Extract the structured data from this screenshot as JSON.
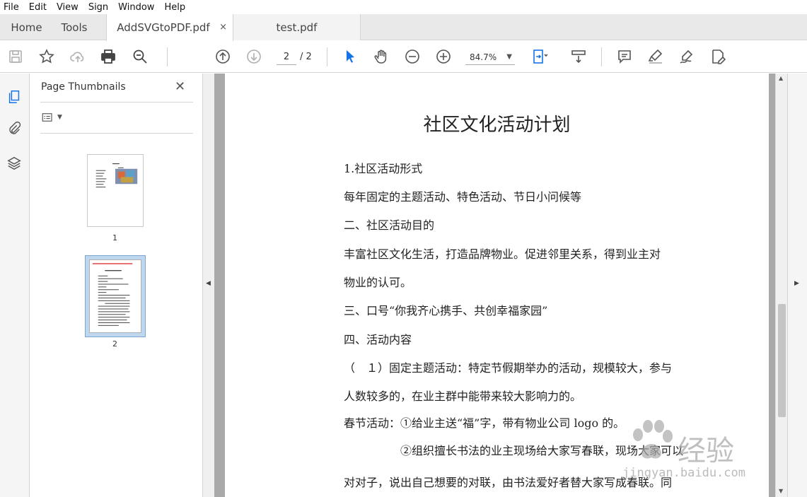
{
  "menu": [
    "File",
    "Edit",
    "View",
    "Sign",
    "Window",
    "Help"
  ],
  "tabs": {
    "home": "Home",
    "tools": "Tools",
    "docs": [
      {
        "label": "AddSVGtoPDF.pdf",
        "close": "×",
        "active": true
      },
      {
        "label": "test.pdf",
        "active": false
      }
    ]
  },
  "toolbar": {
    "page_current": "2",
    "page_total": "/ 2",
    "zoom": "84.7%",
    "icons": [
      "save-icon",
      "star-icon",
      "upload-icon",
      "print-icon",
      "search-zoom-icon",
      "page-up-icon",
      "page-down-icon",
      "select-arrow-icon",
      "hand-icon",
      "zoom-out-icon",
      "zoom-in-icon",
      "fit-page-icon",
      "scroll-mode-icon",
      "comment-icon",
      "highlight-icon",
      "sign-icon",
      "edit-icon"
    ]
  },
  "thumbnails": {
    "title": "Page Thumbnails",
    "close": "✕",
    "pages": [
      "1",
      "2"
    ]
  },
  "document": {
    "title": "社区文化活动计划",
    "lines": [
      "1.社区活动形式",
      "每年固定的主题活动、特色活动、节日小问候等",
      "二、社区活动目的",
      "丰富社区文化生活，打造品牌物业。促进邻里关系，得到业主对",
      "物业的认可。",
      "三、口号“你我齐心携手、共创幸福家园”",
      "四、活动内容",
      "（　１）固定主题活动：特定节假期举办的活动，规模较大，参与",
      "人数较多的，在业主群中能带来较大影响力的。",
      "春节活动：①给业主送“福”字，带有物业公司 logo 的。",
      "　　　　　②组织擅长书法的业主现场给大家写春联，现场大家可以",
      "对对子，说出自己想要的对联，由书法爱好者替大家写成春联。同"
    ]
  },
  "watermark": {
    "text": "经验",
    "url": "jingyan.baidu.com"
  },
  "colors": {
    "accent": "#1473e6",
    "tabbar": "#e9e9e9",
    "docbg": "#a9a9a9"
  }
}
